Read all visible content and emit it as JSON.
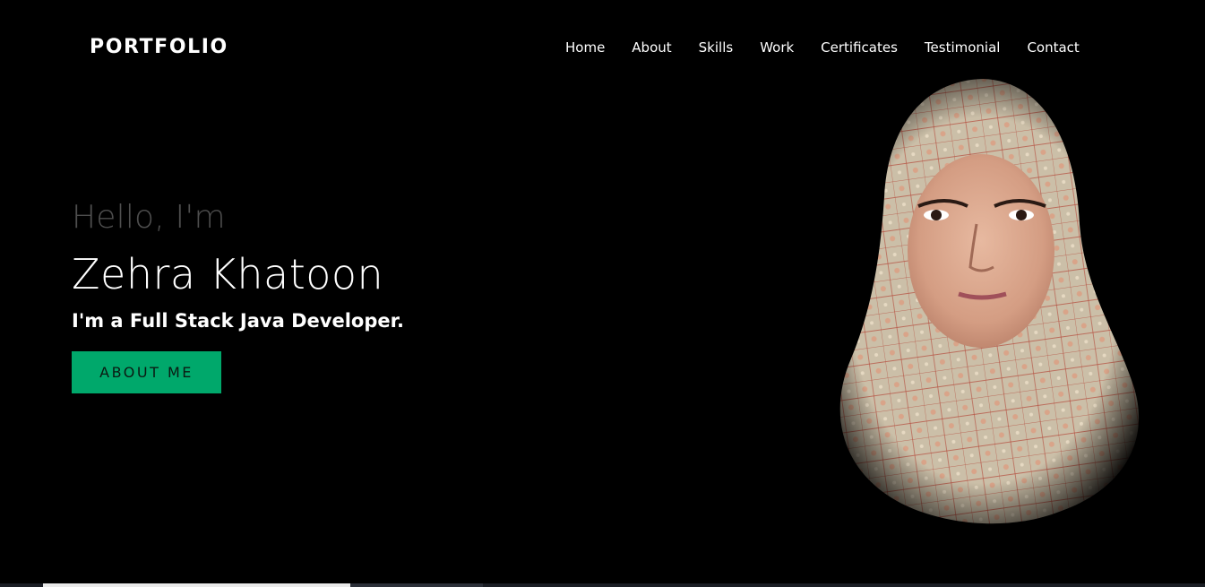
{
  "header": {
    "logo": "PORTFOLIO",
    "nav": [
      {
        "label": "Home"
      },
      {
        "label": "About"
      },
      {
        "label": "Skills"
      },
      {
        "label": "Work"
      },
      {
        "label": "Certificates"
      },
      {
        "label": "Testimonial"
      },
      {
        "label": "Contact"
      }
    ]
  },
  "hero": {
    "greeting": "Hello, I'm",
    "name": "Zehra Khatoon",
    "role": "I'm a Full Stack Java Developer.",
    "button_label": "ABOUT ME",
    "portrait_alt": "portrait-photo"
  },
  "colors": {
    "background": "#000000",
    "accent": "#00a86b",
    "greeting": "#4e4e4e",
    "text": "#ffffff"
  }
}
